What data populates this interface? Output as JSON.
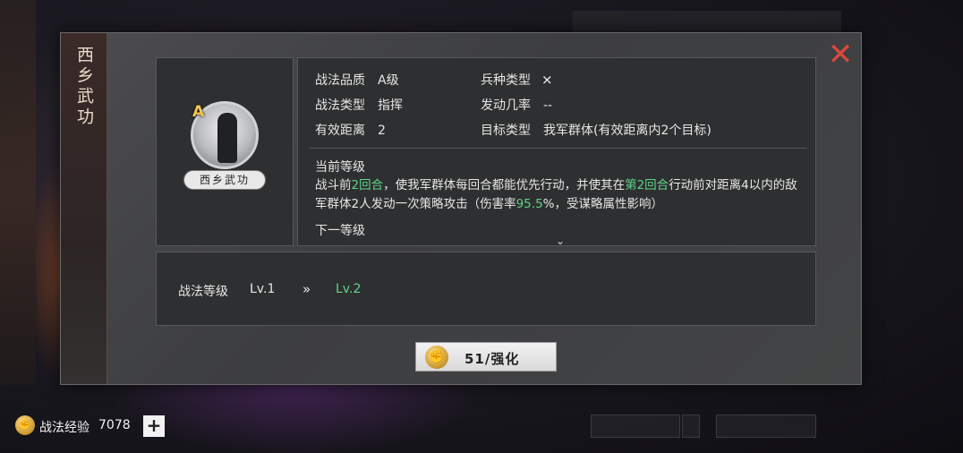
{
  "dialog": {
    "side_title": "西乡武功",
    "close_icon": "close-x-icon",
    "portrait": {
      "grade": "A",
      "plate": "西乡武功"
    },
    "info": {
      "quality_label": "战法品质",
      "quality_value": "A级",
      "troop_label": "兵种类型",
      "troop_icon": "bow-icon",
      "type_label": "战法类型",
      "type_value": "指挥",
      "rate_label": "发动几率",
      "rate_value": "--",
      "range_label": "有效距离",
      "range_value": "2",
      "target_label": "目标类型",
      "target_value": "我军群体(有效距离内2个目标)"
    },
    "current_level_heading": "当前等级",
    "description": {
      "p1": "战斗前",
      "h1": "2回合",
      "p2": "，使我军群体每回合都能优先行动，并使其在",
      "h2": "第2回合",
      "p3": "行动前对距离4以内的敌军群体2人发动一次策略攻击（伤害率",
      "h3": "95.5",
      "p4": "%，受谋略属性影响）"
    },
    "next_level_heading": "下一等级",
    "level": {
      "label": "战法等级",
      "current": "Lv.1",
      "arrow": "»",
      "next": "Lv.2"
    },
    "enhance_button": "51/强化"
  },
  "bottom_bar": {
    "exp_label": "战法经验",
    "exp_value": "7078",
    "plus_label": "+"
  },
  "colors": {
    "highlight": "#5fd38a",
    "close": "#d84a3a",
    "grade": "#f1c64a"
  }
}
